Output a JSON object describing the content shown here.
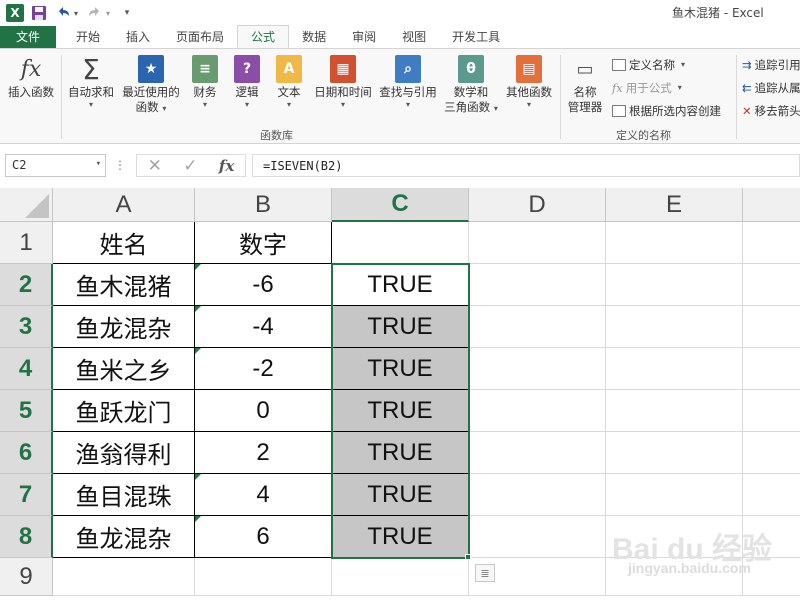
{
  "window": {
    "title": "鱼木混猪 - Excel"
  },
  "tabs": [
    "文件",
    "开始",
    "插入",
    "页面布局",
    "公式",
    "数据",
    "审阅",
    "视图",
    "开发工具"
  ],
  "active_tab": "公式",
  "ribbon": {
    "insert_function": "插入函数",
    "autosum": "自动求和",
    "recent_line1": "最近使用的",
    "recent_line2": "函数",
    "financial": "财务",
    "logical": "逻辑",
    "text": "文本",
    "datetime": "日期和时间",
    "lookup": "查找与引用",
    "math_line1": "数学和",
    "math_line2": "三角函数",
    "other": "其他函数",
    "function_library": "函数库",
    "name_manager_line1": "名称",
    "name_manager_line2": "管理器",
    "define_name": "定义名称",
    "use_in_formula": "用于公式",
    "create_from_selection": "根据所选内容创建",
    "defined_names": "定义的名称",
    "trace_precedents": "追踪引用",
    "trace_dependents": "追踪从属",
    "remove_arrows": "移去箭头"
  },
  "formula_bar": {
    "name_box": "C2",
    "formula": "=ISEVEN(B2)",
    "fx": "fx"
  },
  "grid": {
    "columns": [
      "A",
      "B",
      "C",
      "D",
      "E"
    ],
    "rows": [
      "1",
      "2",
      "3",
      "4",
      "5",
      "6",
      "7",
      "8",
      "9"
    ],
    "header": [
      "姓名",
      "数字",
      ""
    ],
    "data": [
      [
        "鱼木混猪",
        "-6",
        "TRUE"
      ],
      [
        "鱼龙混杂",
        "-4",
        "TRUE"
      ],
      [
        "鱼米之乡",
        "-2",
        "TRUE"
      ],
      [
        "鱼跃龙门",
        "0",
        "TRUE"
      ],
      [
        "渔翁得利",
        "2",
        "TRUE"
      ],
      [
        "鱼目混珠",
        "4",
        "TRUE"
      ],
      [
        "鱼龙混杂",
        "6",
        "TRUE"
      ]
    ]
  },
  "colors": {
    "excel_green": "#217346",
    "selection_fill": "#c6c6c6"
  },
  "watermark": {
    "brand": "Bai du 经验",
    "url": "jingyan.baidu.com"
  }
}
